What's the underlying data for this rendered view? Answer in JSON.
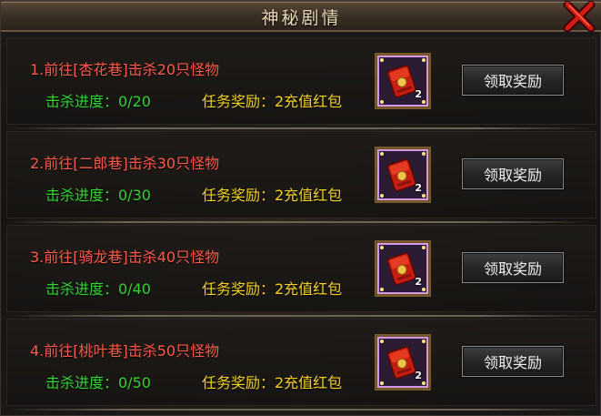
{
  "window": {
    "title": "神秘剧情"
  },
  "quests": [
    {
      "title": "1.前往[杏花巷]击杀20只怪物",
      "progress": "击杀进度：0/20",
      "reward": "任务奖励：2充值红包",
      "item_count": "2",
      "claim_label": "领取奖励"
    },
    {
      "title": "2.前往[二郎巷]击杀30只怪物",
      "progress": "击杀进度：0/30",
      "reward": "任务奖励：2充值红包",
      "item_count": "2",
      "claim_label": "领取奖励"
    },
    {
      "title": "3.前往[骑龙巷]击杀40只怪物",
      "progress": "击杀进度：0/40",
      "reward": "任务奖励：2充值红包",
      "item_count": "2",
      "claim_label": "领取奖励"
    },
    {
      "title": "4.前往[桃叶巷]击杀50只怪物",
      "progress": "击杀进度：0/50",
      "reward": "任务奖励：2充值红包",
      "item_count": "2",
      "claim_label": "领取奖励"
    }
  ],
  "icons": {
    "close": "close-x-icon",
    "reward_item": "red-envelope-icon"
  },
  "colors": {
    "quest_title": "#ff5a4a",
    "progress": "#33d533",
    "reward": "#f3d223",
    "frame_glow": "#c070ff"
  }
}
